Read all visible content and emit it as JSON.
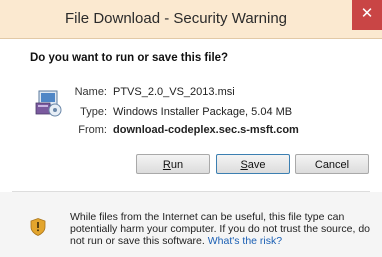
{
  "window": {
    "title": "File Download - Security Warning",
    "close_glyph": "✕"
  },
  "question": "Do you want to run or save this file?",
  "file_icon": "installer-package-icon",
  "fields": {
    "name_label": "Name:",
    "name_value": "PTVS_2.0_VS_2013.msi",
    "type_label": "Type:",
    "type_value": "Windows Installer Package, 5.04 MB",
    "from_label": "From:",
    "from_value": "download-codeplex.sec.s-msft.com"
  },
  "buttons": {
    "run_accel": "R",
    "run_rest": "un",
    "save_accel": "S",
    "save_rest": "ave",
    "cancel": "Cancel"
  },
  "warning": {
    "icon": "shield-icon",
    "text": "While files from the Internet can be useful, this file type can potentially harm your computer. If you do not trust the source, do not run or save this software. ",
    "link": "What's the risk?"
  },
  "colors": {
    "titlebar": "#fbe9d0",
    "close": "#c94545",
    "link": "#1a5fb4"
  }
}
